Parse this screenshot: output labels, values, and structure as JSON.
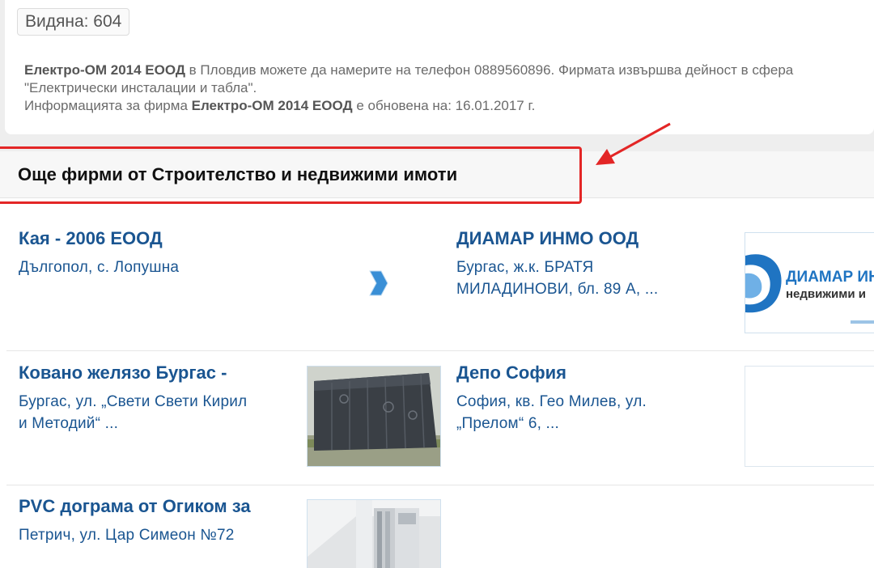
{
  "info": {
    "views": "Видяна: 604",
    "company": "Електро-ОМ 2014 ЕООД",
    "line1_mid": " в Пловдив можете да намерите на телефон 0889560896. Фирмата извършва дейност в сфера",
    "line2": "\"Електрически инсталации и табла\".",
    "line3_pre": "Информацията за фирма ",
    "line3_post": " е обновена на: 16.01.2017 г."
  },
  "section": {
    "title": "Още фирми от Строителство и недвижими имоти"
  },
  "listings": [
    {
      "title": "Кая - 2006 ЕООД",
      "address": "Дългопол, с. Лопушна"
    },
    {
      "title": "ДИАМАР ИНМО ООД",
      "address_line1": "Бургас, ж.к. БРАТЯ",
      "address_line2": "МИЛАДИНОВИ, бл. 89 А, ..."
    },
    {
      "title": "Ковано желязо Бургас -",
      "address_line1": "Бургас, ул. „Свети Свети Кирил",
      "address_line2": "и Методий“ ..."
    },
    {
      "title": "Депо София",
      "address_line1": "София, кв. Гео Милев, ул.",
      "address_line2": "„Прелом“ 6, ..."
    },
    {
      "title": "PVC дограма от Огиком за",
      "address": "Петрич, ул. Цар Симеон №72"
    }
  ],
  "logo": {
    "diamar_line1": "ДИАМАР ИН",
    "diamar_line2": "недвижими и"
  },
  "colors": {
    "link": "#1a5591",
    "highlight": "#e32626",
    "logo_blue": "#1f74c2"
  }
}
